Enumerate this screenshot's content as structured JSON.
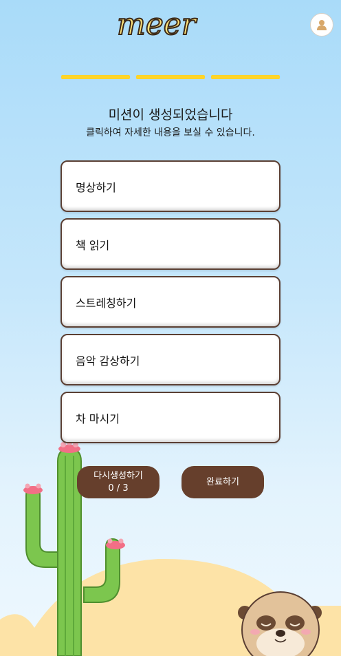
{
  "header": {
    "logo_text": "meer",
    "profile_icon": "user-icon"
  },
  "progress": {
    "steps_total": 3,
    "steps_done": 3
  },
  "intro": {
    "title": "미션이 생성되었습니다",
    "subtitle": "클릭하여 자세한 내용을 보실 수 있습니다."
  },
  "missions": [
    {
      "label": "명상하기"
    },
    {
      "label": "책 읽기"
    },
    {
      "label": "스트레칭하기"
    },
    {
      "label": "음악 감상하기"
    },
    {
      "label": "차 마시기"
    }
  ],
  "actions": {
    "regenerate_label": "다시생성하기",
    "regenerate_count": "0 / 3",
    "complete_label": "완료하기"
  },
  "colors": {
    "accent": "#ffd42a",
    "button": "#663f2c",
    "card_border": "#5b3f33",
    "sky_top": "#a9dbf9",
    "sand": "#fde3a7"
  }
}
